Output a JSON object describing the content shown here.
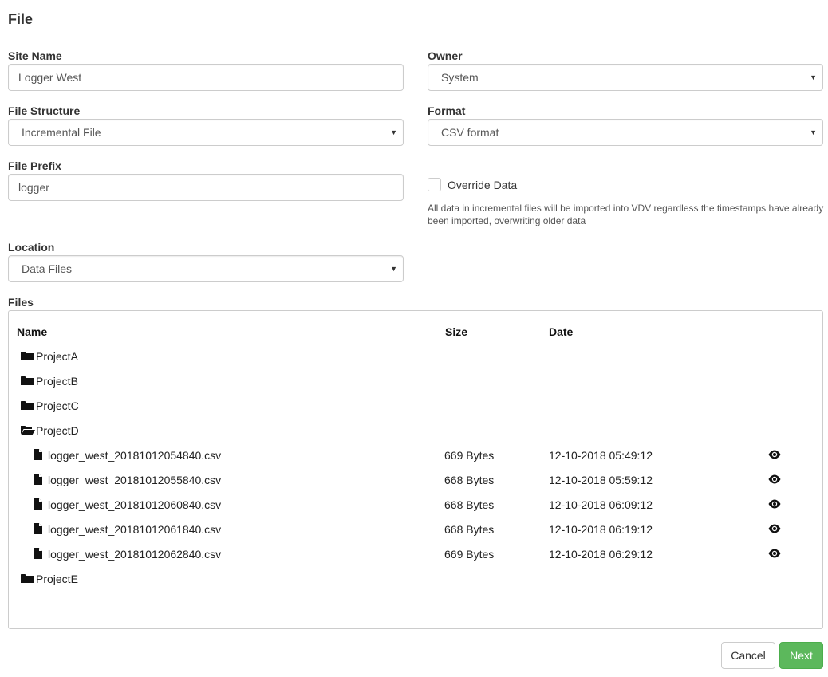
{
  "page": {
    "title": "File"
  },
  "form": {
    "site_name": {
      "label": "Site Name",
      "value": "Logger West"
    },
    "owner": {
      "label": "Owner",
      "value": "System"
    },
    "file_structure": {
      "label": "File Structure",
      "value": "Incremental File"
    },
    "format": {
      "label": "Format",
      "value": "CSV format"
    },
    "file_prefix": {
      "label": "File Prefix",
      "value": "logger"
    },
    "override": {
      "label": "Override Data",
      "checked": false,
      "help": "All data in incremental files will be imported into VDV regardless the timestamps have already been imported, overwriting older data"
    },
    "location": {
      "label": "Location",
      "value": "Data Files"
    }
  },
  "files": {
    "label": "Files",
    "columns": {
      "name": "Name",
      "size": "Size",
      "date": "Date"
    },
    "rows": [
      {
        "type": "folder",
        "name": "ProjectA",
        "open": false
      },
      {
        "type": "folder",
        "name": "ProjectB",
        "open": false
      },
      {
        "type": "folder",
        "name": "ProjectC",
        "open": false
      },
      {
        "type": "folder",
        "name": "ProjectD",
        "open": true
      },
      {
        "type": "file",
        "name": "logger_west_20181012054840.csv",
        "size": "669 Bytes",
        "date": "12-10-2018 05:49:12"
      },
      {
        "type": "file",
        "name": "logger_west_20181012055840.csv",
        "size": "668 Bytes",
        "date": "12-10-2018 05:59:12"
      },
      {
        "type": "file",
        "name": "logger_west_20181012060840.csv",
        "size": "668 Bytes",
        "date": "12-10-2018 06:09:12"
      },
      {
        "type": "file",
        "name": "logger_west_20181012061840.csv",
        "size": "668 Bytes",
        "date": "12-10-2018 06:19:12"
      },
      {
        "type": "file",
        "name": "logger_west_20181012062840.csv",
        "size": "669 Bytes",
        "date": "12-10-2018 06:29:12"
      },
      {
        "type": "folder",
        "name": "ProjectE",
        "open": false
      }
    ]
  },
  "buttons": {
    "cancel": "Cancel",
    "next": "Next"
  },
  "colors": {
    "primary_green": "#5cb85c",
    "border": "#cccccc"
  }
}
